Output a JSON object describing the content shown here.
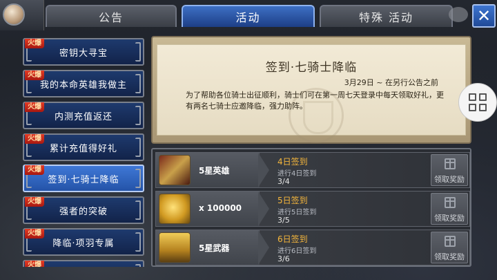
{
  "tabs": [
    {
      "label": "公告"
    },
    {
      "label": "活动"
    },
    {
      "label": "特殊 活动"
    }
  ],
  "close_label": "✕",
  "events": [
    {
      "tag": "火爆",
      "label": "密钥大寻宝"
    },
    {
      "tag": "火爆",
      "label": "我的本命英雄我做主"
    },
    {
      "tag": "火爆",
      "label": "内测充值返还"
    },
    {
      "tag": "火爆",
      "label": "累计充值得好礼"
    },
    {
      "tag": "火爆",
      "label": "签到·七骑士降临"
    },
    {
      "tag": "火爆",
      "label": "强者的突破"
    },
    {
      "tag": "火爆",
      "label": "降临·项羽专属"
    },
    {
      "tag": "火爆",
      "label": ""
    }
  ],
  "detail": {
    "title": "签到·七骑士降临",
    "date": "3月29日 ~ 在另行公告之前",
    "description": "为了帮助各位骑士出征顺利，骑士们可在第一周七天登录中每天领取好礼，更有两名七骑士应邀降临，强力助阵。"
  },
  "rewards": [
    {
      "icon": "hero-card-icon",
      "name": "5星英雄",
      "title": "4日签到",
      "desc": "进行4日签到",
      "progress": "3/4",
      "claim": "领取奖励"
    },
    {
      "icon": "gold-coins-icon",
      "name": "x 100000",
      "title": "5日签到",
      "desc": "进行5日签到",
      "progress": "3/5",
      "claim": "领取奖励"
    },
    {
      "icon": "golden-weapon-chest-icon",
      "name": "5星武器",
      "title": "6日签到",
      "desc": "进行6日签到",
      "progress": "3/6",
      "claim": "领取奖励"
    }
  ]
}
